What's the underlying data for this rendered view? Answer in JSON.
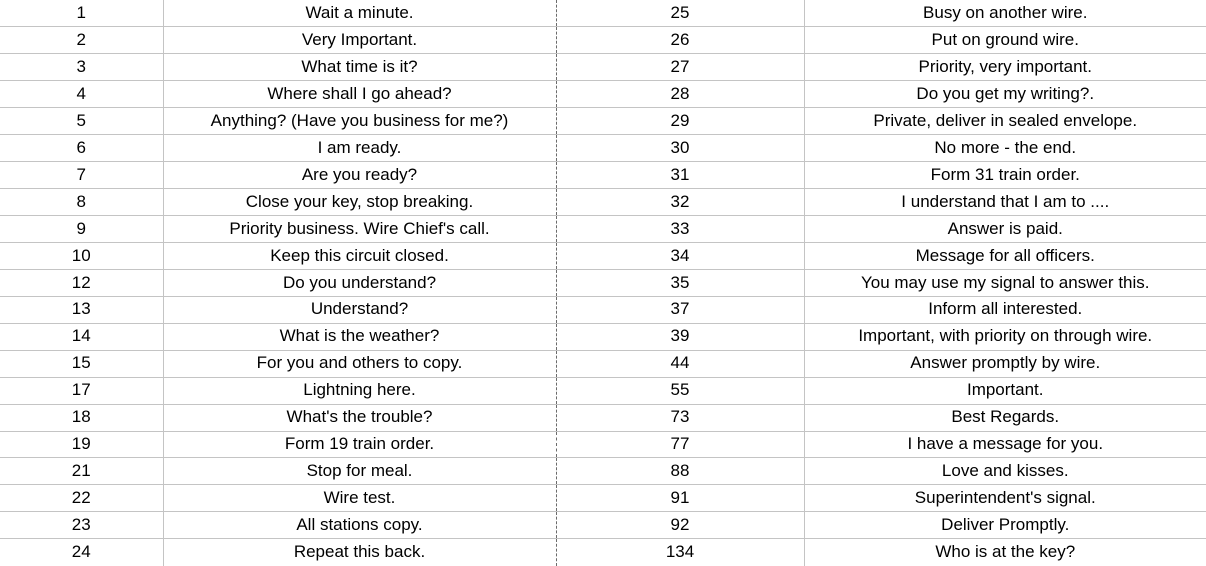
{
  "sheet": {
    "type": "table",
    "columns": 4,
    "row_count": 21,
    "grid_color": "#c4c4c4",
    "page_break_color": "#6b6b6b",
    "background": "#ffffff",
    "text_color": "#000000"
  },
  "table": {
    "rows": [
      {
        "left_num": "1",
        "left_text": "Wait a minute.",
        "right_num": "25",
        "right_text": "Busy on another wire."
      },
      {
        "left_num": "2",
        "left_text": "Very Important.",
        "right_num": "26",
        "right_text": "Put on ground wire."
      },
      {
        "left_num": "3",
        "left_text": "What time is it?",
        "right_num": "27",
        "right_text": "Priority, very important."
      },
      {
        "left_num": "4",
        "left_text": "Where shall I go ahead?",
        "right_num": "28",
        "right_text": "Do you get my writing?."
      },
      {
        "left_num": "5",
        "left_text": "Anything? (Have you business for me?)",
        "right_num": "29",
        "right_text": "Private, deliver in sealed envelope."
      },
      {
        "left_num": "6",
        "left_text": "I am ready.",
        "right_num": "30",
        "right_text": "No more - the end."
      },
      {
        "left_num": "7",
        "left_text": "Are you ready?",
        "right_num": "31",
        "right_text": "Form 31 train order."
      },
      {
        "left_num": "8",
        "left_text": "Close your key, stop breaking.",
        "right_num": "32",
        "right_text": "I understand that I am to ...."
      },
      {
        "left_num": "9",
        "left_text": "Priority business. Wire Chief's call.",
        "right_num": "33",
        "right_text": "Answer is paid."
      },
      {
        "left_num": "10",
        "left_text": "Keep this circuit closed.",
        "right_num": "34",
        "right_text": "Message for all officers."
      },
      {
        "left_num": "12",
        "left_text": "Do you understand?",
        "right_num": "35",
        "right_text": "You may use my signal to answer this."
      },
      {
        "left_num": "13",
        "left_text": "Understand?",
        "right_num": "37",
        "right_text": "Inform all interested."
      },
      {
        "left_num": "14",
        "left_text": "What is the weather?",
        "right_num": "39",
        "right_text": "Important, with priority on through wire."
      },
      {
        "left_num": "15",
        "left_text": "For you and others to copy.",
        "right_num": "44",
        "right_text": "Answer promptly by wire."
      },
      {
        "left_num": "17",
        "left_text": "Lightning here.",
        "right_num": "55",
        "right_text": "Important."
      },
      {
        "left_num": "18",
        "left_text": "What's the trouble?",
        "right_num": "73",
        "right_text": "Best Regards."
      },
      {
        "left_num": "19",
        "left_text": "Form 19 train order.",
        "right_num": "77",
        "right_text": "I have a message for you."
      },
      {
        "left_num": "21",
        "left_text": "Stop for meal.",
        "right_num": "88",
        "right_text": "Love and kisses."
      },
      {
        "left_num": "22",
        "left_text": "Wire test.",
        "right_num": "91",
        "right_text": "Superintendent's signal."
      },
      {
        "left_num": "23",
        "left_text": "All stations copy.",
        "right_num": "92",
        "right_text": "Deliver Promptly."
      },
      {
        "left_num": "24",
        "left_text": "Repeat this back.",
        "right_num": "134",
        "right_text": "Who is at the key?"
      }
    ]
  }
}
